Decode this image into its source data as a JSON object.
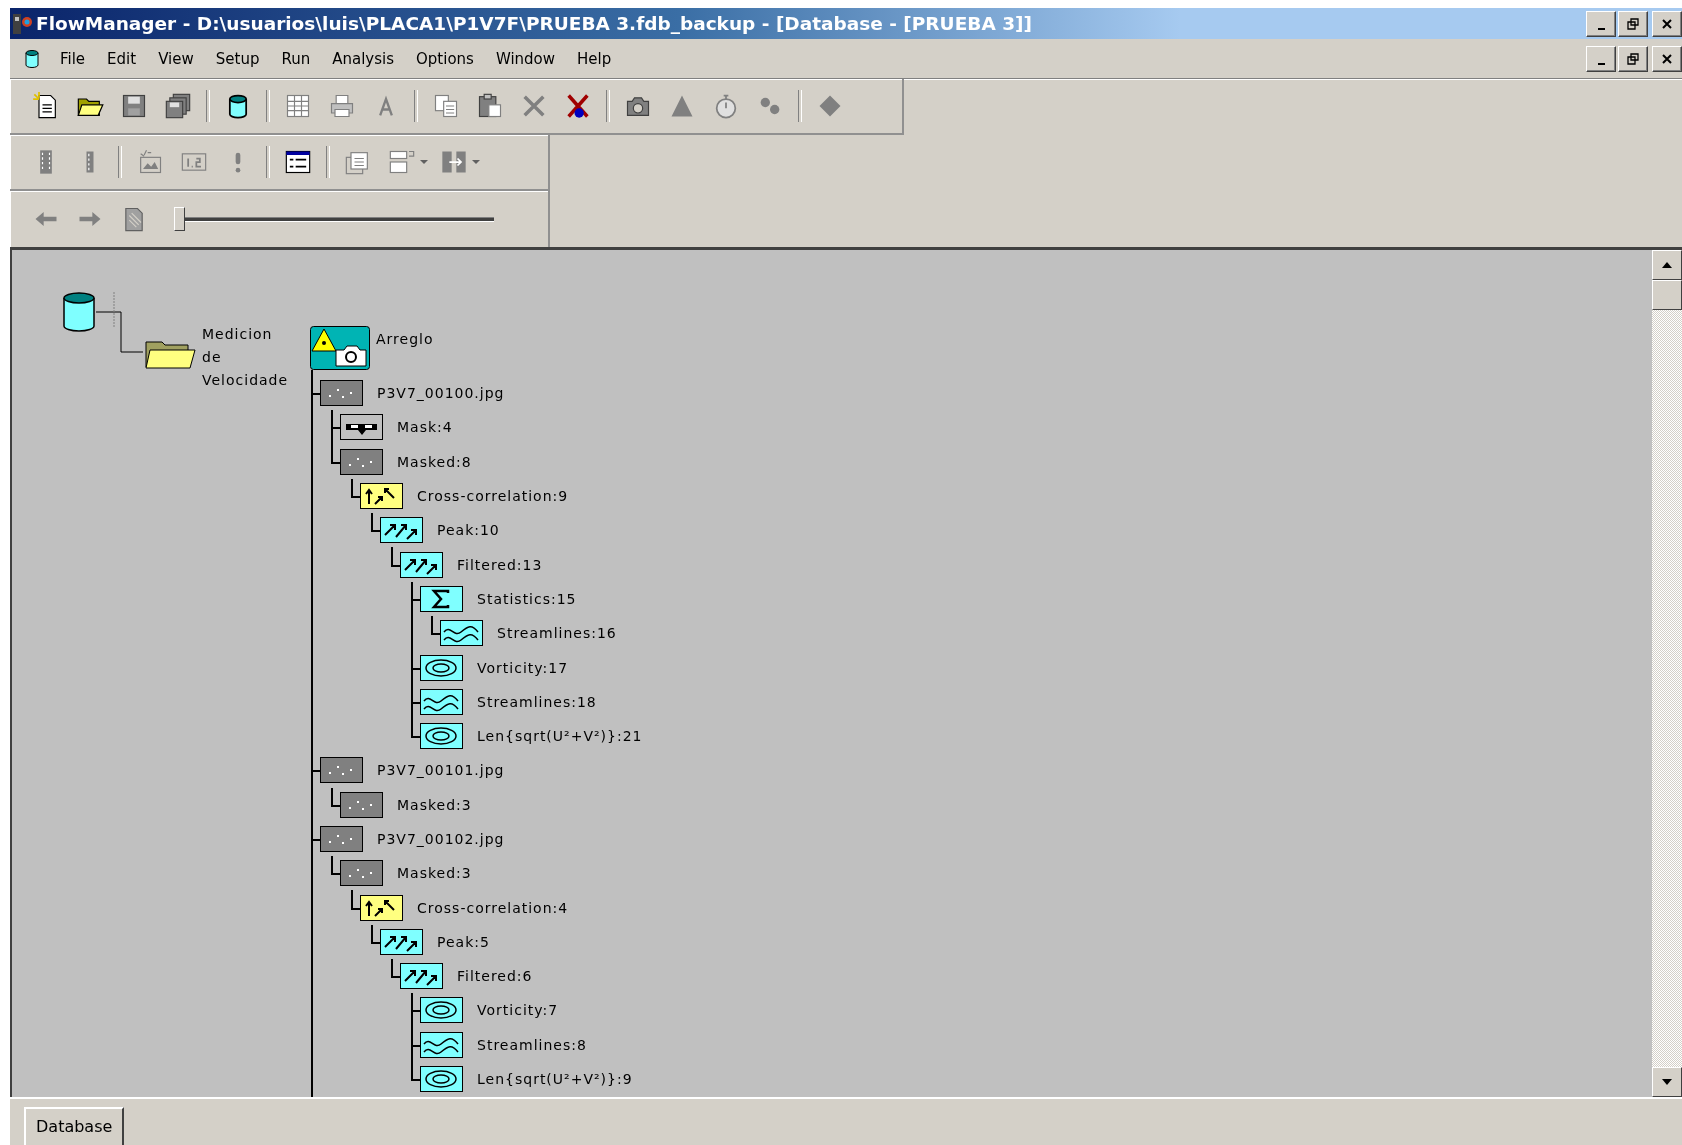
{
  "window": {
    "title": "FlowManager - D:\\usuarios\\luis\\PLACA1\\P1V7F\\PRUEBA 3.fdb_backup - [Database - [PRUEBA 3]]"
  },
  "menu": [
    "File",
    "Edit",
    "View",
    "Setup",
    "Run",
    "Analysis",
    "Options",
    "Window",
    "Help"
  ],
  "frame_slider": {
    "level": 0
  },
  "tree": {
    "folder": {
      "label": "Medicion de Velocidade"
    },
    "project": {
      "label": "Arreglo"
    },
    "items": [
      {
        "label": "P3V7_00100.jpg",
        "kind": "image",
        "children": [
          {
            "label": "Mask:4",
            "kind": "mask"
          },
          {
            "label": "Masked:8",
            "kind": "image",
            "children": [
              {
                "label": "Cross-correlation:9",
                "kind": "correlation",
                "children": [
                  {
                    "label": "Peak:10",
                    "kind": "vectors",
                    "children": [
                      {
                        "label": "Filtered:13",
                        "kind": "vectors",
                        "children": [
                          {
                            "label": "Statistics:15",
                            "kind": "statistics",
                            "children": [
                              {
                                "label": "Streamlines:16",
                                "kind": "streamlines"
                              }
                            ]
                          },
                          {
                            "label": "Vorticity:17",
                            "kind": "contour"
                          },
                          {
                            "label": "Streamlines:18",
                            "kind": "streamlines"
                          },
                          {
                            "label": "Len{sqrt(U²+V²)}:21",
                            "kind": "contour"
                          }
                        ]
                      }
                    ]
                  }
                ]
              }
            ]
          }
        ]
      },
      {
        "label": "P3V7_00101.jpg",
        "kind": "image",
        "children": [
          {
            "label": "Masked:3",
            "kind": "image"
          }
        ]
      },
      {
        "label": "P3V7_00102.jpg",
        "kind": "image",
        "children": [
          {
            "label": "Masked:3",
            "kind": "image",
            "children": [
              {
                "label": "Cross-correlation:4",
                "kind": "correlation",
                "children": [
                  {
                    "label": "Peak:5",
                    "kind": "vectors",
                    "children": [
                      {
                        "label": "Filtered:6",
                        "kind": "vectors",
                        "children": [
                          {
                            "label": "Vorticity:7",
                            "kind": "contour"
                          },
                          {
                            "label": "Streamlines:8",
                            "kind": "streamlines"
                          },
                          {
                            "label": "Len{sqrt(U²+V²)}:9",
                            "kind": "contour"
                          }
                        ]
                      }
                    ]
                  }
                ]
              }
            ]
          }
        ]
      }
    ]
  },
  "status_bar": {
    "tabs": [
      {
        "label": "Database",
        "selected": true
      }
    ]
  }
}
